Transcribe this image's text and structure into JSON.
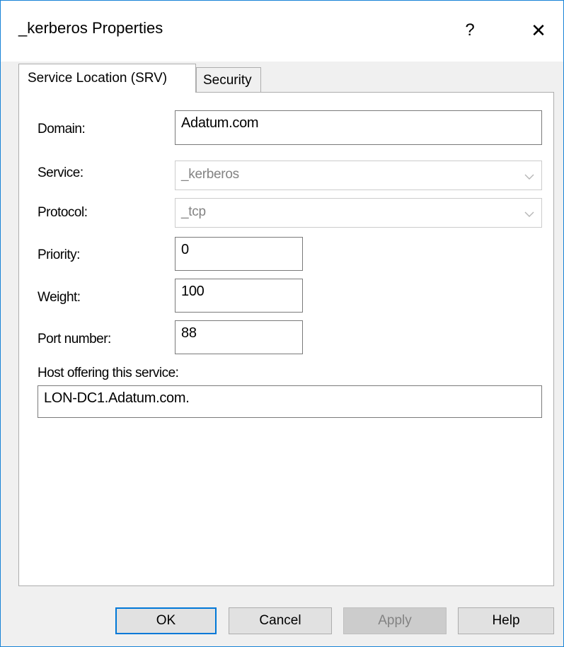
{
  "window": {
    "title": "_kerberos Properties",
    "help_glyph": "?",
    "close_glyph": "✕"
  },
  "tabs": [
    {
      "label": "Service Location (SRV)",
      "active": true
    },
    {
      "label": "Security",
      "active": false
    }
  ],
  "form": {
    "domain_label": "Domain:",
    "domain_value": "Adatum.com",
    "service_label": "Service:",
    "service_value": "_kerberos",
    "protocol_label": "Protocol:",
    "protocol_value": "_tcp",
    "priority_label": "Priority:",
    "priority_value": "0",
    "weight_label": "Weight:",
    "weight_value": "100",
    "port_label": "Port number:",
    "port_value": "88",
    "host_label": "Host offering this service:",
    "host_value": "LON-DC1.Adatum.com."
  },
  "buttons": {
    "ok": "OK",
    "cancel": "Cancel",
    "apply": "Apply",
    "help": "Help"
  },
  "icons": {
    "help": "help-icon",
    "close": "close-icon",
    "dropdown": "chevron-down-icon"
  },
  "colors": {
    "window_border": "#1883d7",
    "default_button_border": "#0078d7",
    "disabled_text": "#838383"
  }
}
